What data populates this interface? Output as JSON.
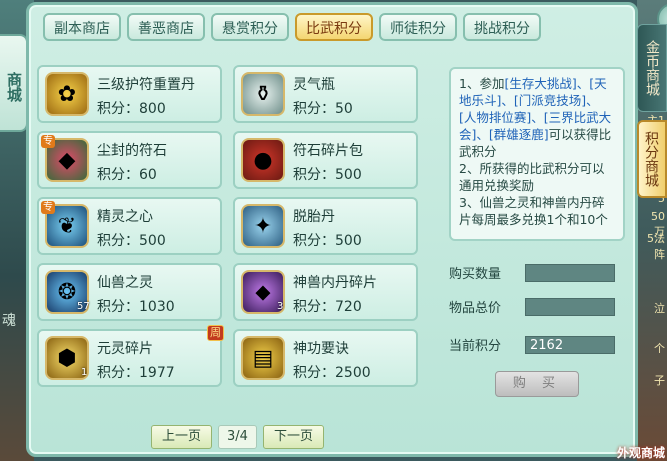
{
  "left_label": "商城",
  "tabs": [
    {
      "label": "副本商店",
      "active": false
    },
    {
      "label": "善恶商店",
      "active": false
    },
    {
      "label": "悬赏积分",
      "active": false
    },
    {
      "label": "比武积分",
      "active": true
    },
    {
      "label": "师徒积分",
      "active": false
    },
    {
      "label": "挑战积分",
      "active": false
    }
  ],
  "items": [
    {
      "name": "三级护符重置丹",
      "price": "积分：800",
      "icon": "golden-lotus-icon"
    },
    {
      "name": "灵气瓶",
      "price": "积分：50",
      "icon": "spirit-bottle-icon"
    },
    {
      "name": "尘封的符石",
      "price": "积分：60",
      "icon": "rune-stone-icon",
      "tag": "专"
    },
    {
      "name": "符石碎片包",
      "price": "积分：500",
      "icon": "red-bag-icon"
    },
    {
      "name": "精灵之心",
      "price": "积分：500",
      "icon": "spirit-heart-icon",
      "tag": "专"
    },
    {
      "name": "脱胎丹",
      "price": "积分：500",
      "icon": "blue-pill-icon"
    },
    {
      "name": "仙兽之灵",
      "price": "积分：1030",
      "icon": "beast-spirit-icon",
      "count": "57"
    },
    {
      "name": "神兽内丹碎片",
      "price": "积分：720",
      "icon": "purple-crystal-icon",
      "count": "3"
    },
    {
      "name": "元灵碎片",
      "price": "积分：1977",
      "icon": "gold-shard-icon",
      "count": "1",
      "week": "周"
    },
    {
      "name": "神功要诀",
      "price": "积分：2500",
      "icon": "golden-book-icon"
    }
  ],
  "pager": {
    "prev": "上一页",
    "page": "3/4",
    "next": "下一页"
  },
  "info": {
    "line1_a": "1、参加",
    "line1_b": "[生存大挑战]、[天地乐斗]、[门派竞技场]、[人物排位赛]、[三界比武大会]、[群雄逐鹿]",
    "line1_c": "可以获得比武积分",
    "line2": "2、所获得的比武积分可以通用兑换奖励",
    "line3": "3、仙兽之灵和神兽内丹碎片每周最多兑换1个和10个"
  },
  "form": {
    "qty_label": "购买数量",
    "qty_value": "",
    "total_label": "物品总价",
    "total_value": "",
    "points_label": "当前积分",
    "points_value": "2162"
  },
  "buy_label": "购 买",
  "close_label": "×",
  "side_tabs": {
    "gold": "金币商城",
    "points": "积分商城"
  },
  "bg_text": [
    "主1",
    "5",
    "50万",
    "5法阵",
    "泣",
    "魂",
    "个",
    "子"
  ],
  "outer_shop_label": "外观商城"
}
